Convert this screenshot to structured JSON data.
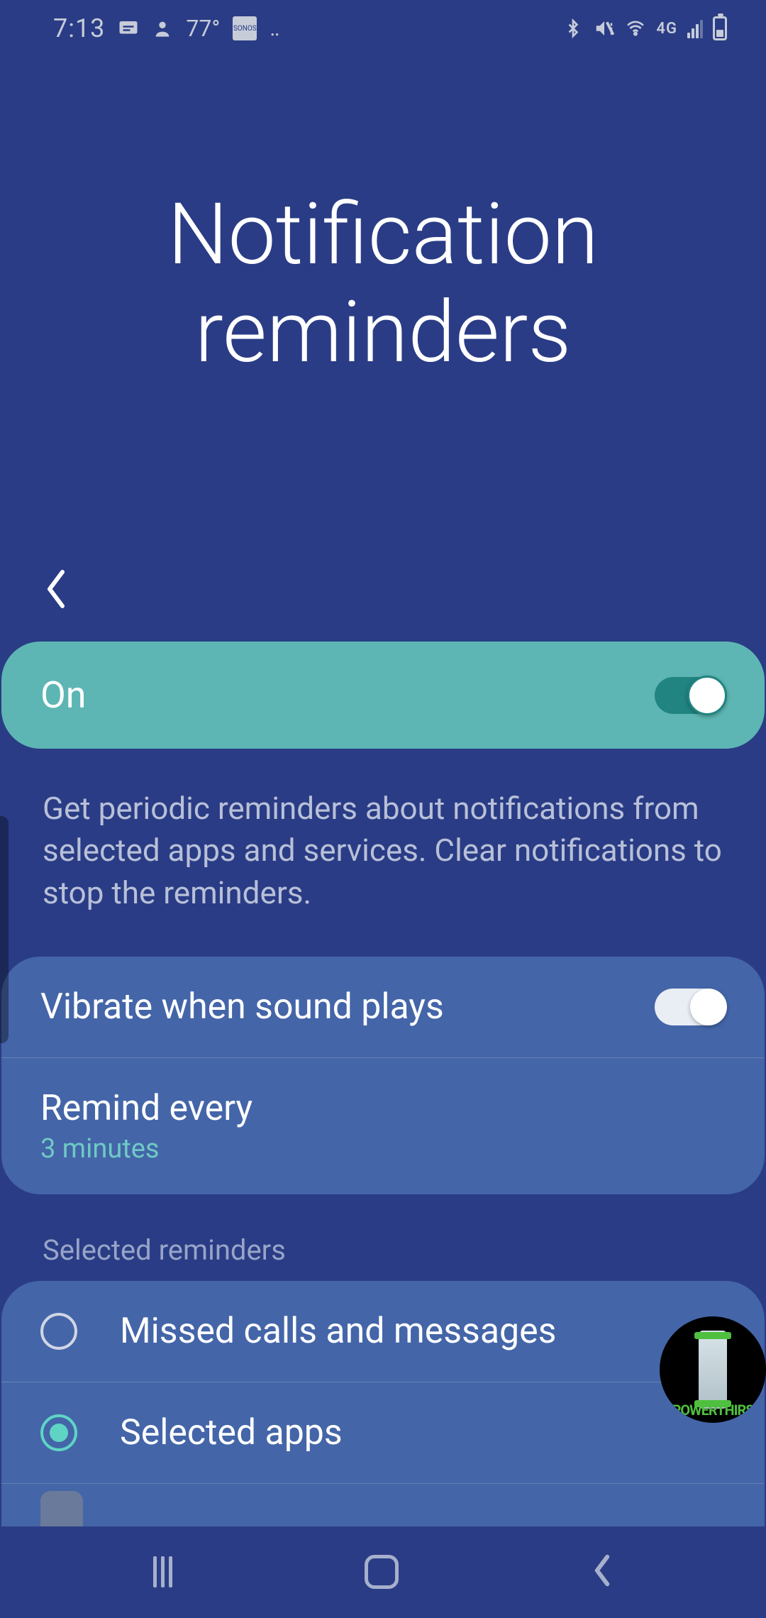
{
  "status": {
    "time": "7:13",
    "temp": "77°",
    "sonos": "SONOS",
    "lge": "4G",
    "dots": "‥"
  },
  "header": {
    "title": "Notification reminders"
  },
  "master": {
    "label": "On",
    "enabled": true
  },
  "description": "Get periodic reminders about notifications from selected apps and services. Clear notifications to stop the reminders.",
  "settings": {
    "vibrate": {
      "label": "Vibrate when sound plays",
      "enabled": true
    },
    "remind": {
      "label": "Remind every",
      "value": "3 minutes"
    }
  },
  "section_header": "Selected reminders",
  "reminders": [
    {
      "label": "Missed calls and messages",
      "selected": false
    },
    {
      "label": "Selected apps",
      "selected": true
    }
  ],
  "overlay": {
    "text": "POWERTHIRS"
  }
}
